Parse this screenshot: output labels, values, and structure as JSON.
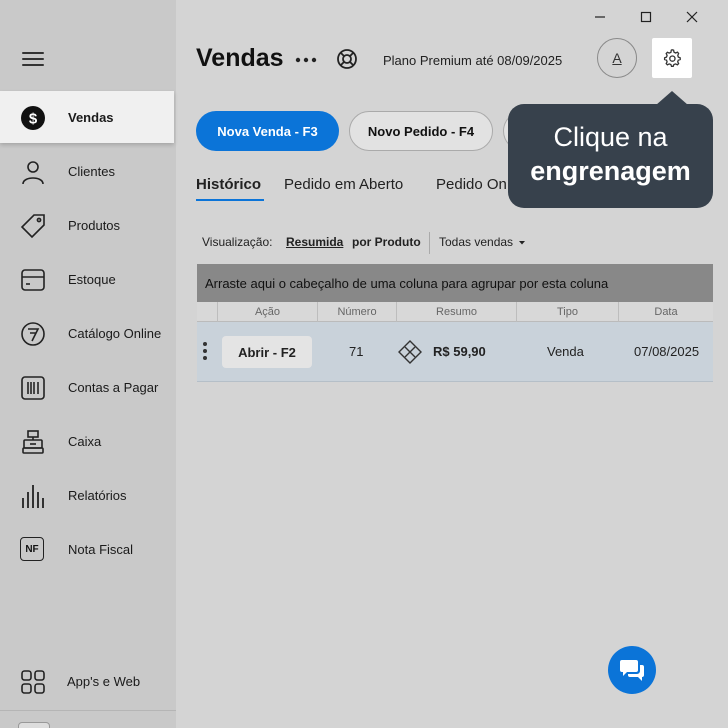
{
  "window": {
    "minimize_icon": "minimize-icon",
    "maximize_icon": "maximize-icon",
    "close_icon": "close-icon"
  },
  "sidebar": {
    "items": [
      {
        "label": "Vendas",
        "icon": "dollar-icon",
        "active": true
      },
      {
        "label": "Clientes",
        "icon": "user-icon"
      },
      {
        "label": "Produtos",
        "icon": "tag-icon"
      },
      {
        "label": "Estoque",
        "icon": "box-icon"
      },
      {
        "label": "Catálogo Online",
        "icon": "catalog-icon"
      },
      {
        "label": "Contas a Pagar",
        "icon": "barcode-icon"
      },
      {
        "label": "Caixa",
        "icon": "cash-register-icon"
      },
      {
        "label": "Relatórios",
        "icon": "bar-chart-icon"
      },
      {
        "label": "Nota Fiscal",
        "icon": "nf-icon",
        "icon_text": "NF"
      }
    ],
    "apps": {
      "label": "App's e Web",
      "icon": "grid-icon"
    }
  },
  "header": {
    "title": "Vendas",
    "plan": "Plano Premium até 08/09/2025",
    "avatar_letter": "A"
  },
  "actions": {
    "primary": "Nova Venda - F3",
    "secondary": "Novo Pedido - F4"
  },
  "tabs": [
    {
      "label": "Histórico",
      "active": true
    },
    {
      "label": "Pedido em Aberto"
    },
    {
      "label": "Pedido On"
    }
  ],
  "visualization": {
    "label": "Visualização:",
    "option1": "Resumida",
    "option2": "por Produto",
    "filter": "Todas vendas"
  },
  "grid": {
    "group_hint": "Arraste aqui o cabeçalho de uma coluna para agrupar por esta coluna",
    "columns": [
      "Ação",
      "Número",
      "Resumo",
      "Tipo",
      "Data"
    ],
    "rows": [
      {
        "action": "Abrir - F2",
        "numero": "71",
        "resumo": "R$ 59,90",
        "tipo": "Venda",
        "data": "07/08/2025"
      }
    ]
  },
  "tooltip": {
    "line1": "Clique na",
    "line2": "engrenagem"
  },
  "colors": {
    "accent": "#0b74d8",
    "tooltip_bg": "#37414c"
  }
}
